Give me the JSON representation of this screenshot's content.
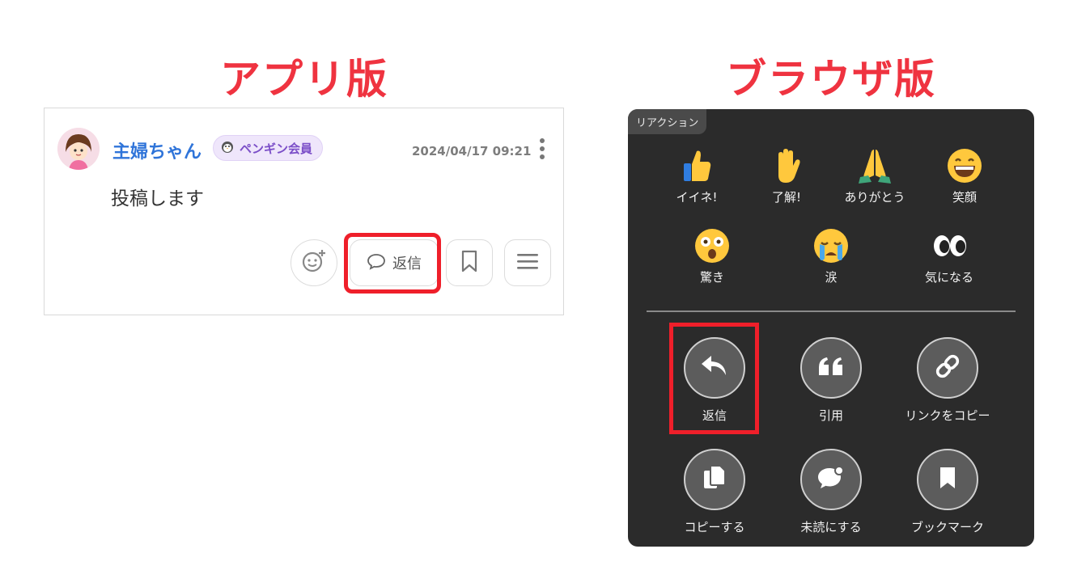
{
  "headings": {
    "app": "アプリ版",
    "browser": "ブラウザ版"
  },
  "app_post": {
    "username": "主婦ちゃん",
    "badge": "ペンギン会員",
    "timestamp": "2024/04/17 09:21",
    "body": "投稿します",
    "reply_label": "返信",
    "icons": [
      "avatar",
      "penguin-icon",
      "more-vertical-icon",
      "add-reaction-icon",
      "speech-bubble-icon",
      "bookmark-icon",
      "menu-icon"
    ]
  },
  "browser_panel": {
    "tag": "リアクション",
    "reactions": [
      {
        "label": "イイネ!",
        "icon": "thumbs-up-icon"
      },
      {
        "label": "了解!",
        "icon": "raised-hand-icon"
      },
      {
        "label": "ありがとう",
        "icon": "folded-hands-icon"
      },
      {
        "label": "笑顔",
        "icon": "grinning-face-icon"
      },
      {
        "label": "驚き",
        "icon": "astonished-face-icon"
      },
      {
        "label": "涙",
        "icon": "crying-face-icon"
      },
      {
        "label": "気になる",
        "icon": "eyes-icon"
      }
    ],
    "tools": [
      {
        "label": "返信",
        "icon": "reply-icon"
      },
      {
        "label": "引用",
        "icon": "quote-icon"
      },
      {
        "label": "リンクをコピー",
        "icon": "link-icon"
      },
      {
        "label": "コピーする",
        "icon": "copy-icon"
      },
      {
        "label": "未読にする",
        "icon": "unread-bubble-icon"
      },
      {
        "label": "ブックマーク",
        "icon": "bookmark-icon"
      }
    ]
  },
  "colors": {
    "highlight": "#ef1f2a",
    "heading": "#ef3340",
    "username": "#2f74d9",
    "panel": "#2b2b2b"
  }
}
